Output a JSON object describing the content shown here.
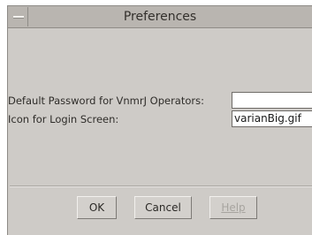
{
  "window": {
    "title": "Preferences"
  },
  "form": {
    "password_label": "Default Password for VnmrJ Operators:",
    "password_value": "",
    "icon_label": "Icon for Login Screen:",
    "icon_value": "varianBig.gif"
  },
  "buttons": {
    "ok": "OK",
    "cancel": "Cancel",
    "help": "Help",
    "help_enabled": false
  }
}
